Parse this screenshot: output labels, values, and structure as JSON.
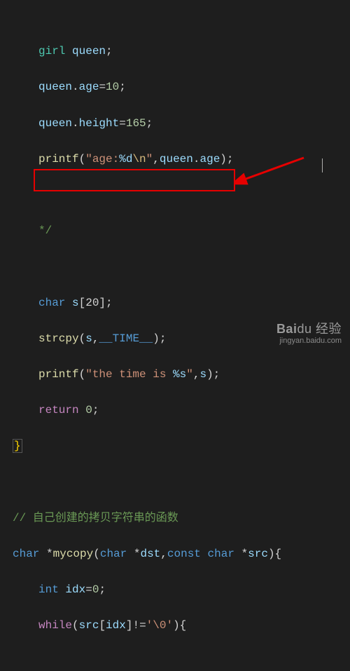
{
  "code": {
    "l1_type": "girl",
    "l1_var": "queen",
    "l2_var": "queen",
    "l2_prop": "age",
    "l2_val": "10",
    "l3_var": "queen",
    "l3_prop": "height",
    "l3_val": "165",
    "l4_func": "printf",
    "l4_str1": "\"age:",
    "l4_fmt": "%d",
    "l4_esc": "\\n",
    "l4_str2": "\"",
    "l4_arg_obj": "queen",
    "l4_arg_prop": "age",
    "l5_cmtend": "*/",
    "l6_type": "char",
    "l6_var": "s",
    "l6_dim": "[20]",
    "l7_func": "strcpy",
    "l7_arg1": "s",
    "l7_macro": "__TIME__",
    "l8_func": "printf",
    "l8_str1": "\"the time is ",
    "l8_fmt": "%s",
    "l8_str2": "\"",
    "l8_arg": "s",
    "l9_ret": "return",
    "l9_val": "0",
    "l10_brace": "}",
    "l11_cmt": "// 自己创建的拷贝字符串的函数",
    "l12_type": "char",
    "l12_name": "mycopy",
    "l12_p1t": "char",
    "l12_p1n": "dst",
    "l12_const": "const",
    "l12_p2t": "char",
    "l12_p2n": "src",
    "l13_type": "int",
    "l13_var": "idx",
    "l13_val": "0",
    "l14_kw": "while",
    "l14_arr": "src",
    "l14_idx": "idx",
    "l14_neq": "!=",
    "l14_ch": "'\\0'"
  },
  "watermark": {
    "main_a": "Bai",
    "main_b": "du",
    "main_c": "经验",
    "sub": "jingyan.baidu.com"
  }
}
